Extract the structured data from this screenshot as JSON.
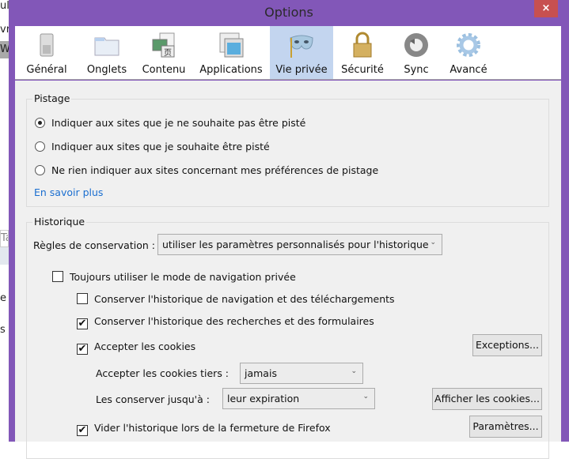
{
  "background_fragments": [
    "ul",
    "vr",
    "W",
    "Ta",
    "e",
    "s"
  ],
  "window": {
    "title": "Options",
    "close_label": "×"
  },
  "toolbar": {
    "tabs": [
      {
        "label": "Général",
        "icon": "switch-icon"
      },
      {
        "label": "Onglets",
        "icon": "folder-tab-icon"
      },
      {
        "label": "Contenu",
        "icon": "content-icon"
      },
      {
        "label": "Applications",
        "icon": "applications-icon"
      },
      {
        "label": "Vie privée",
        "icon": "mask-icon",
        "selected": true
      },
      {
        "label": "Sécurité",
        "icon": "padlock-icon"
      },
      {
        "label": "Sync",
        "icon": "sync-icon"
      },
      {
        "label": "Avancé",
        "icon": "gear-icon"
      }
    ]
  },
  "tracking": {
    "legend": "Pistage",
    "options": [
      {
        "label": "Indiquer aux sites que je ne souhaite pas être pisté",
        "selected": true
      },
      {
        "label": "Indiquer aux sites que je souhaite être pisté",
        "selected": false
      },
      {
        "label": "Ne rien indiquer aux sites concernant mes préférences de pistage",
        "selected": false
      }
    ],
    "learn_more": "En savoir plus"
  },
  "history": {
    "legend": "Historique",
    "rules_label": "Règles de conservation :",
    "rules_value": "utiliser les paramètres personnalisés pour l'historique",
    "always_private": {
      "label": "Toujours utiliser le mode de navigation privée",
      "checked": false
    },
    "keep_browsing": {
      "label": "Conserver l'historique de navigation et des téléchargements",
      "checked": false
    },
    "keep_search": {
      "label": "Conserver l'historique des recherches et des formulaires",
      "checked": true
    },
    "accept_cookies": {
      "label": "Accepter les cookies",
      "checked": true
    },
    "exceptions_button": "Exceptions...",
    "third_party_label": "Accepter les cookies tiers :",
    "third_party_value": "jamais",
    "keep_until_label": "Les conserver jusqu'à :",
    "keep_until_value": "leur expiration",
    "show_cookies_button": "Afficher les cookies...",
    "clear_on_close": {
      "label": "Vider l'historique lors de la fermeture de Firefox",
      "checked": true
    },
    "settings_button": "Paramètres..."
  },
  "colors": {
    "frame": "#8257b8",
    "close": "#c75050",
    "selected_tab": "#c3d5ef",
    "link": "#1a6ed0"
  }
}
